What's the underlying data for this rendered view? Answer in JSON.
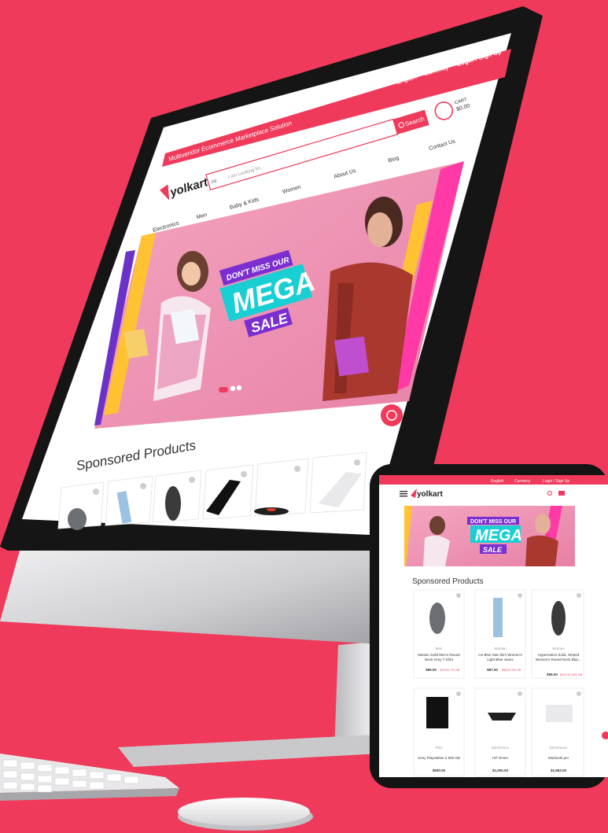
{
  "colors": {
    "background": "#ef3a5b",
    "accent": "#ef3a5b",
    "bezel": "#151515",
    "silver": "#d8d8da",
    "banner": "#e98fb0",
    "cyan": "#19cfd4",
    "yellow": "#ffc233"
  },
  "desktop": {
    "topbar": {
      "english": "English",
      "currency": "Currency",
      "login": "Login / Sign Up"
    },
    "tagline": "Multivendor Ecommerce Marketplace Solution",
    "logo": "yolkart",
    "search": {
      "category": "All",
      "placeholder": "I am Looking for...",
      "button": "Search"
    },
    "cart": {
      "label": "CART",
      "total": "$0.00",
      "count": "0"
    },
    "nav": [
      "Electronics",
      "Men",
      "Baby & Kids",
      "Women",
      "About Us",
      "Blog",
      "Contact Us"
    ],
    "banner": {
      "line1": "DON'T MISS OUR",
      "line2": "MEGA",
      "line3": "SALE"
    },
    "sponsored_title": "Sponsored Products"
  },
  "tablet": {
    "topbar": {
      "english": "English",
      "currency": "Currency",
      "login": "Login / Sign Up"
    },
    "logo": "yolkart",
    "banner": {
      "line1": "DON'T MISS OUR",
      "line2": "MEGA",
      "line3": "SALE"
    },
    "sponsored_title": "Sponsored Products",
    "products": [
      {
        "category": "Men",
        "name": "Maniac Solid Men's Round",
        "name2": "Neck Grey T-Shirt",
        "price": "$65.00",
        "old": "$79.00 7% Off"
      },
      {
        "category": "Women",
        "name": "Ice Blue Star Slim Women's",
        "name2": "Light Blue Jeans",
        "price": "$87.00",
        "old": "$99.00 9% Off"
      },
      {
        "category": "Women",
        "name": "Hypernation Solid, Striped",
        "name2": "Women's Round Neck Blac...",
        "price": "$95.00",
        "old": "$110.00 15% Off"
      },
      {
        "category": "PS4",
        "name": "Sony Playstation 4 500 GB",
        "name2": "",
        "price": "$500.00",
        "old": ""
      },
      {
        "category": "Electronics",
        "name": "HP Omen",
        "name2": "",
        "price": "$1,000.00",
        "old": ""
      },
      {
        "category": "Electronics",
        "name": "Macbook pro",
        "name2": "",
        "price": "$1,863.00",
        "old": ""
      }
    ]
  }
}
